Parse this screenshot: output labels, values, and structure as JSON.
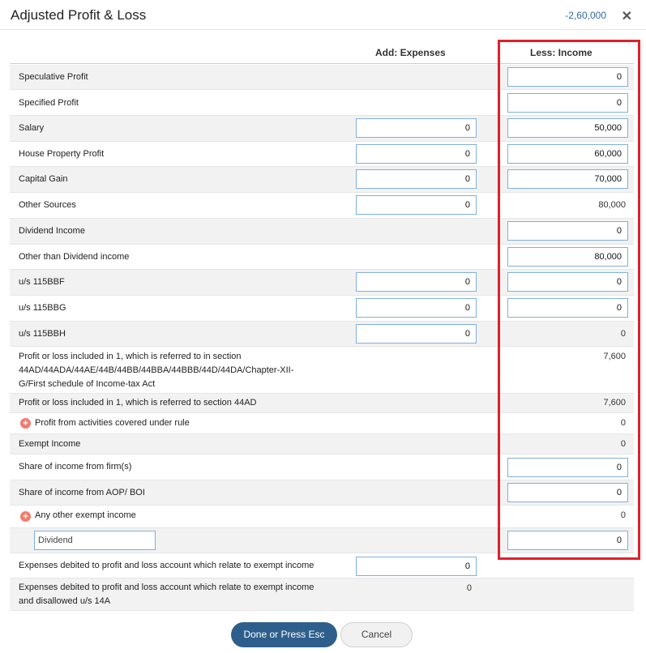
{
  "header": {
    "title": "Adjusted Profit & Loss",
    "total": "-2,60,000",
    "close_glyph": "✕"
  },
  "columns": {
    "expenses": "Add: Expenses",
    "income": "Less: Income"
  },
  "rows": [
    {
      "label": "Speculative Profit",
      "income": "0"
    },
    {
      "label": "Specified Profit",
      "income": "0"
    },
    {
      "label": "Salary",
      "expenses": "0",
      "income": "50,000"
    },
    {
      "label": "House Property Profit",
      "expenses": "0",
      "income": "60,000"
    },
    {
      "label": "Capital Gain",
      "expenses": "0",
      "income": "70,000"
    },
    {
      "label": "Other Sources",
      "expenses": "0",
      "income": "80,000"
    },
    {
      "label": "Dividend Income",
      "income": "0"
    },
    {
      "label": "Other than Dividend income",
      "income": "80,000"
    },
    {
      "label": "u/s 115BBF",
      "expenses": "0",
      "income": "0"
    },
    {
      "label": "u/s 115BBG",
      "expenses": "0",
      "income": "0"
    },
    {
      "label": "u/s 115BBH",
      "expenses": "0",
      "income": "0"
    },
    {
      "label_lines": [
        "Profit or loss included in 1, which is referred to in section",
        "44AD/44ADA/44AE/44B/44BB/44BBA/44BBB/44D/44DA/Chapter-XII-",
        "G/First schedule of Income-tax Act"
      ],
      "income": "7,600"
    },
    {
      "label": "Profit or loss included in 1, which is referred to section 44AD",
      "income": "7,600"
    },
    {
      "label": "Profit from activities covered under rule",
      "income": "0"
    },
    {
      "label": "Exempt Income",
      "income": "0"
    },
    {
      "label": "Share of income from firm(s)",
      "income": "0"
    },
    {
      "label": "Share of income from AOP/ BOI",
      "income": "0"
    },
    {
      "label": "Any other exempt income",
      "income": "0"
    },
    {
      "placeholder": "Dividend",
      "income": "0"
    },
    {
      "label": "Expenses debited to profit and loss account which relate to exempt income",
      "expenses": "0"
    },
    {
      "label_lines": [
        "Expenses debited to profit and loss account which relate to exempt income",
        "and disallowed u/s 14A"
      ],
      "expenses": "0"
    }
  ],
  "buttons": {
    "done": "Done or Press Esc",
    "cancel": "Cancel"
  },
  "colors": {
    "accent": "#2e5f8c",
    "highlight": "#e0202c",
    "input_border": "#7fb0de"
  },
  "icons": {
    "plus": "+"
  }
}
